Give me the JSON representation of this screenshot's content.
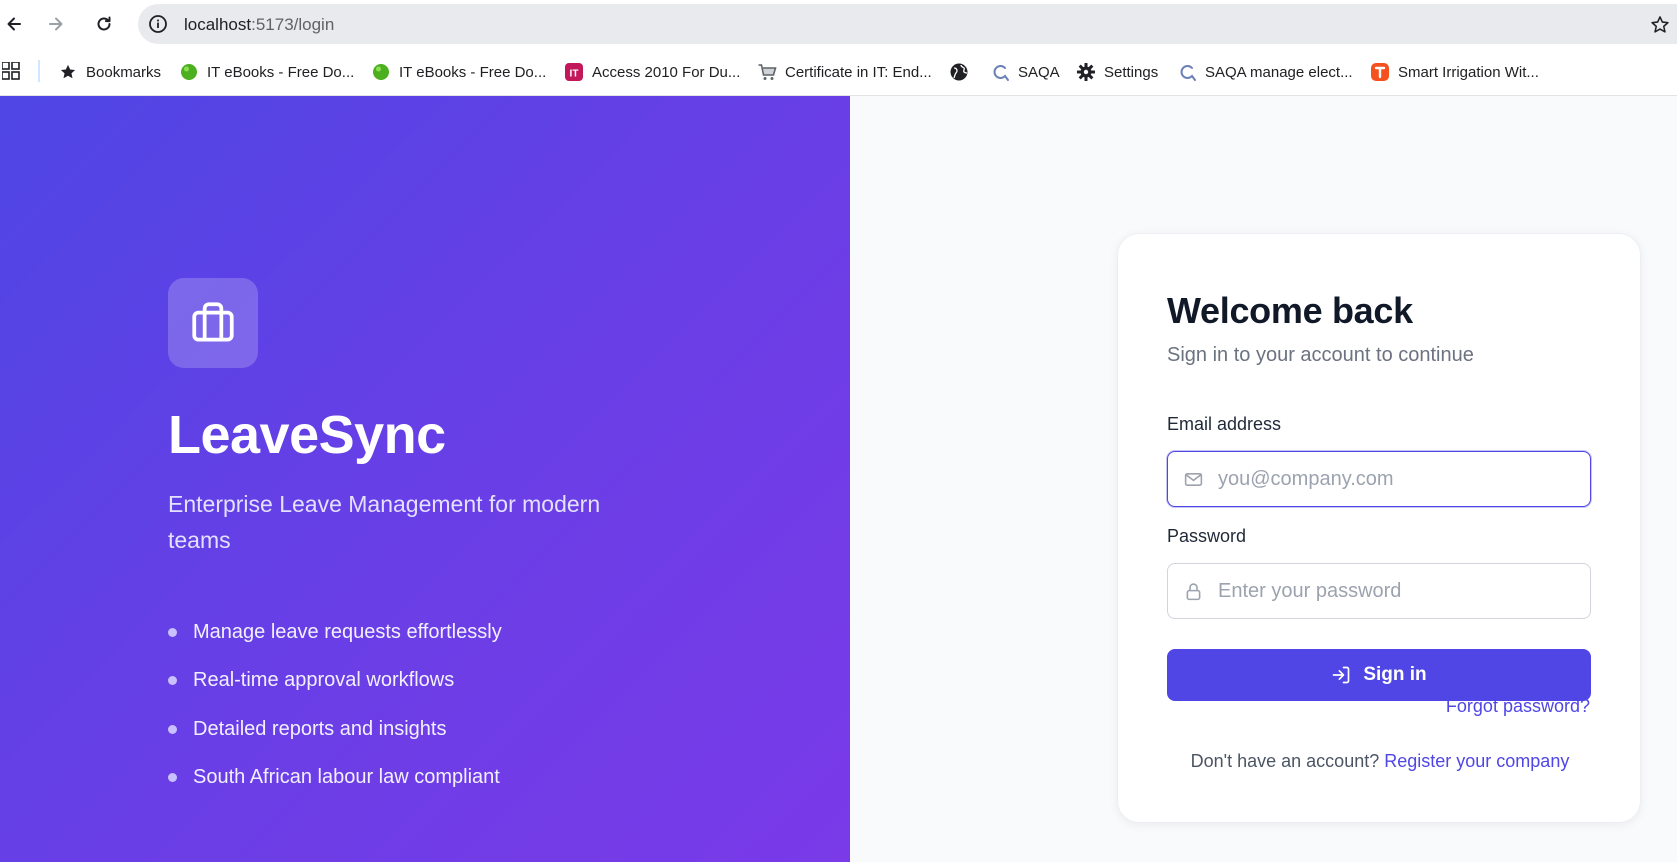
{
  "browser": {
    "url_host": "localhost",
    "url_rest": ":5173/login",
    "bookmarks": [
      {
        "label": "Bookmarks",
        "icon": "star-icon"
      },
      {
        "label": "IT eBooks - Free Do...",
        "icon": "green-ball-icon"
      },
      {
        "label": "IT eBooks - Free Do...",
        "icon": "green-ball-icon"
      },
      {
        "label": "Access 2010 For Du...",
        "icon": "it-logo-icon"
      },
      {
        "label": "Certificate in IT: End...",
        "icon": "cart-icon"
      },
      {
        "label": "",
        "icon": "globe-icon"
      },
      {
        "label": "SAQA",
        "icon": "saqa-icon"
      },
      {
        "label": "Settings",
        "icon": "gear-icon"
      },
      {
        "label": "SAQA manage elect...",
        "icon": "saqa-icon"
      },
      {
        "label": "Smart Irrigation Wit...",
        "icon": "orange-tool-icon"
      }
    ]
  },
  "hero": {
    "brand": "LeaveSync",
    "tagline": "Enterprise Leave Management for modern teams",
    "features": [
      "Manage leave requests effortlessly",
      "Real-time approval workflows",
      "Detailed reports and insights",
      "South African labour law compliant"
    ]
  },
  "login": {
    "title": "Welcome back",
    "subtitle": "Sign in to your account to continue",
    "email_label": "Email address",
    "email_placeholder": "you@company.com",
    "email_value": "",
    "password_label": "Password",
    "password_placeholder": "Enter your password",
    "password_value": "",
    "signin_label": "Sign in",
    "forgot_label": "Forgot password?",
    "no_account_text": "Don't have an account?",
    "register_label": "Register your company"
  },
  "colors": {
    "accent": "#4f46e5",
    "hero_gradient_start": "#4f46e5",
    "hero_gradient_end": "#7a3ae8",
    "page_bg": "#f9fafb"
  }
}
